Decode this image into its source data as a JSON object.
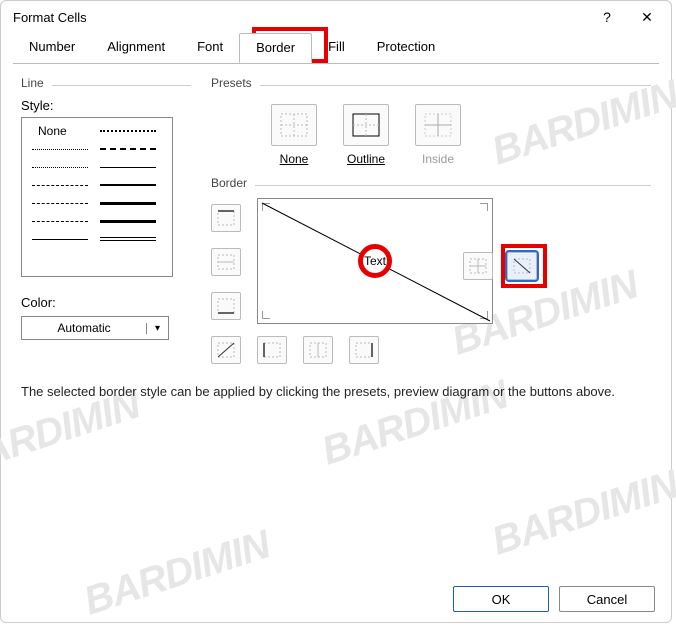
{
  "dialog": {
    "title": "Format Cells",
    "help_glyph": "?",
    "close_glyph": "✕"
  },
  "tabs": {
    "items": [
      "Number",
      "Alignment",
      "Font",
      "Border",
      "Fill",
      "Protection"
    ],
    "active_index": 3
  },
  "line": {
    "group_label": "Line",
    "style_label": "Style:",
    "none_label": "None",
    "color_label": "Color:",
    "color_value": "Automatic"
  },
  "presets": {
    "group_label": "Presets",
    "items": [
      {
        "label": "None",
        "enabled": true
      },
      {
        "label": "Outline",
        "enabled": true
      },
      {
        "label": "Inside",
        "enabled": false
      }
    ]
  },
  "border": {
    "group_label": "Border",
    "preview_text": "Text",
    "side_buttons": [
      "border-top",
      "border-middle-h",
      "border-bottom"
    ],
    "bottom_buttons": [
      "border-diag-up",
      "border-left",
      "border-middle-v",
      "border-right"
    ],
    "extra_buttons": [
      "border-grid",
      "border-diag-down"
    ],
    "active_extra_index": 1
  },
  "help_text": "The selected border style can be applied by clicking the presets, preview diagram or the buttons above.",
  "footer": {
    "ok": "OK",
    "cancel": "Cancel"
  },
  "watermark_text": "BARDIMIN"
}
